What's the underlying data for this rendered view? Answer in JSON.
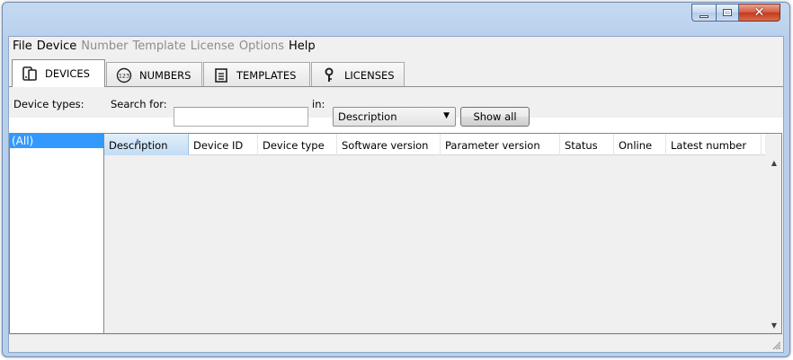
{
  "window": {
    "title": "",
    "controls": {
      "minimize": "minimize",
      "maximize": "maximize",
      "close": "close"
    }
  },
  "menu": [
    {
      "label": "File",
      "enabled": true
    },
    {
      "label": "Device",
      "enabled": true
    },
    {
      "label": "Number",
      "enabled": false
    },
    {
      "label": "Template",
      "enabled": false
    },
    {
      "label": "License",
      "enabled": false
    },
    {
      "label": "Options",
      "enabled": false
    },
    {
      "label": "Help",
      "enabled": true
    }
  ],
  "tabs": [
    {
      "label": "DEVICES",
      "icon": "device-icon",
      "active": true
    },
    {
      "label": "NUMBERS",
      "icon": "numbers-123-icon",
      "active": false
    },
    {
      "label": "TEMPLATES",
      "icon": "template-document-icon",
      "active": false
    },
    {
      "label": "LICENSES",
      "icon": "key-icon",
      "active": false
    }
  ],
  "filters": {
    "device_types_label": "Device types:",
    "search_label": "Search for:",
    "search_value": "",
    "in_label": "in:",
    "search_field_selected": "Description",
    "show_all_label": "Show all"
  },
  "device_types": [
    "(All)"
  ],
  "table": {
    "columns": [
      "Description",
      "Device ID",
      "Device type",
      "Software version",
      "Parameter version",
      "Status",
      "Online",
      "Latest number"
    ],
    "sorted_column": "Description",
    "rows": []
  },
  "colors": {
    "selection": "#3399ff",
    "window_frame": "#b7cfec",
    "close_button": "#c4381c"
  }
}
